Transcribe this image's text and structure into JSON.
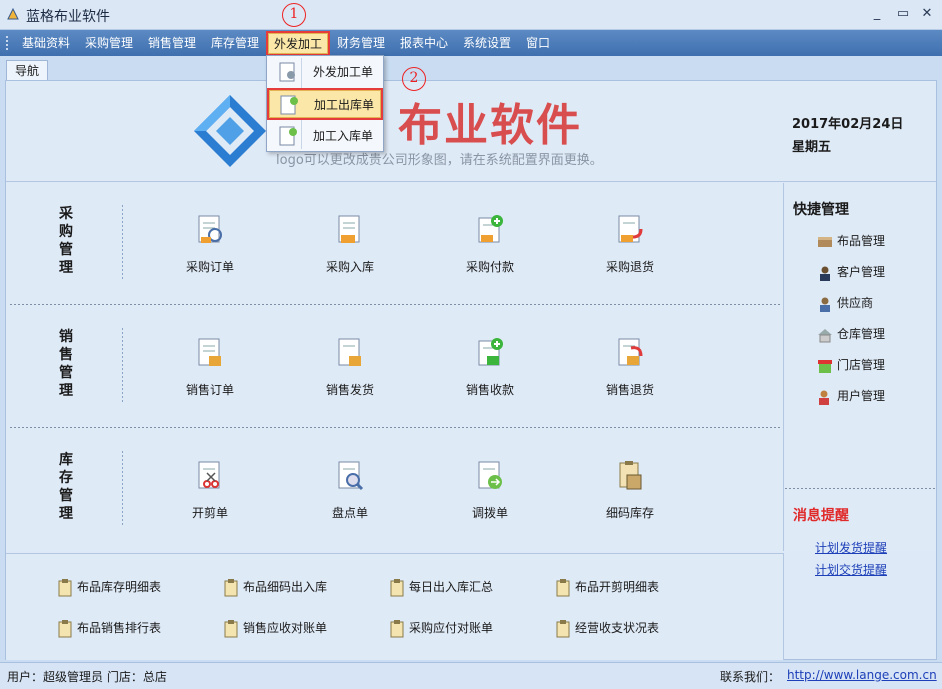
{
  "window": {
    "title": "蓝格布业软件",
    "minimize": "_",
    "restore": "▭",
    "close": "✕"
  },
  "menubar": {
    "items": [
      "基础资料",
      "采购管理",
      "销售管理",
      "库存管理",
      "外发加工",
      "财务管理",
      "报表中心",
      "系统设置",
      "窗口"
    ],
    "active_index": 4
  },
  "annotations": [
    "1",
    "2"
  ],
  "dropdown": {
    "items": [
      {
        "label": "外发加工单",
        "icon": "doc-gear-icon"
      },
      {
        "label": "加工出库单",
        "icon": "doc-out-icon"
      },
      {
        "label": "加工入库单",
        "icon": "doc-in-icon"
      }
    ],
    "active_index": 1
  },
  "tab": {
    "label": "导航"
  },
  "banner": {
    "logo_text": "布业软件",
    "hint": "logo可以更改成贵公司形象图，请在系统配置界面更换。",
    "date": "2017年02月24日",
    "weekday": "星期五"
  },
  "sections": [
    {
      "title": [
        "采",
        "购",
        "管",
        "理"
      ],
      "tiles": [
        {
          "label": "采购订单",
          "icon": "purchase-order-icon"
        },
        {
          "label": "采购入库",
          "icon": "purchase-in-icon"
        },
        {
          "label": "采购付款",
          "icon": "purchase-pay-icon"
        },
        {
          "label": "采购退货",
          "icon": "purchase-return-icon"
        }
      ]
    },
    {
      "title": [
        "销",
        "售",
        "管",
        "理"
      ],
      "tiles": [
        {
          "label": "销售订单",
          "icon": "sales-order-icon"
        },
        {
          "label": "销售发货",
          "icon": "sales-ship-icon"
        },
        {
          "label": "销售收款",
          "icon": "sales-receipt-icon"
        },
        {
          "label": "销售退货",
          "icon": "sales-return-icon"
        }
      ]
    },
    {
      "title": [
        "库",
        "存",
        "管",
        "理"
      ],
      "tiles": [
        {
          "label": "开剪单",
          "icon": "cut-order-icon"
        },
        {
          "label": "盘点单",
          "icon": "inventory-check-icon"
        },
        {
          "label": "调拨单",
          "icon": "transfer-icon"
        },
        {
          "label": "细码库存",
          "icon": "detail-stock-icon"
        }
      ]
    }
  ],
  "quick": {
    "title": "快捷管理",
    "items": [
      {
        "label": "布品管理",
        "icon": "fabric-icon"
      },
      {
        "label": "客户管理",
        "icon": "customer-icon"
      },
      {
        "label": "供应商",
        "icon": "supplier-icon"
      },
      {
        "label": "仓库管理",
        "icon": "warehouse-icon"
      },
      {
        "label": "门店管理",
        "icon": "store-icon"
      },
      {
        "label": "用户管理",
        "icon": "user-icon"
      }
    ],
    "message_title": "消息提醒",
    "links": [
      "计划发货提醒",
      "计划交货提醒"
    ]
  },
  "reports": [
    [
      "布品库存明细表",
      "布品细码出入库",
      "每日出入库汇总",
      "布品开剪明细表"
    ],
    [
      "布品销售排行表",
      "销售应收对账单",
      "采购应付对账单",
      "经营收支状况表"
    ]
  ],
  "status": {
    "user_store": "用户：超级管理员  门店：总店",
    "contact_label": "联系我们：",
    "url": "http://www.lange.com.cn"
  },
  "colors": {
    "menubar": "#4a7bbb",
    "active_menu": "#fbe7a8",
    "annotation": "#e53b3b",
    "logo_red": "#d84d4d",
    "logo_blue": "#2a7dd1"
  }
}
